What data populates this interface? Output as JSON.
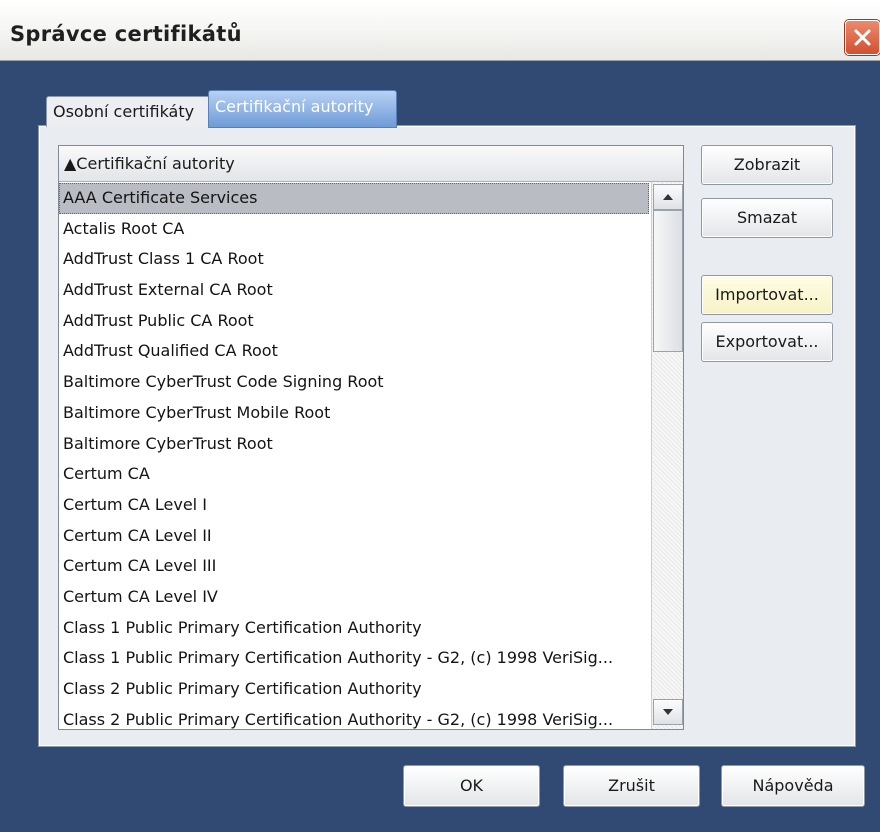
{
  "window": {
    "title": "Správce certifikátů",
    "close_icon": "close-icon"
  },
  "tabs": [
    {
      "label": "Osobní certifikáty",
      "active": false
    },
    {
      "label": "Certifikační autority",
      "active": true
    }
  ],
  "list": {
    "header": "▲Certifikační autority",
    "selected_index": 0,
    "items": [
      "AAA Certificate Services",
      "Actalis Root CA",
      "AddTrust Class 1 CA Root",
      "AddTrust External CA Root",
      "AddTrust Public CA Root",
      "AddTrust Qualified CA Root",
      "Baltimore CyberTrust Code Signing Root",
      "Baltimore CyberTrust Mobile Root",
      "Baltimore CyberTrust Root",
      "Certum CA",
      "Certum CA Level I",
      "Certum CA Level II",
      "Certum CA Level III",
      "Certum CA Level IV",
      "Class 1 Public Primary Certification Authority",
      "Class 1 Public Primary Certification Authority - G2, (c) 1998 VeriSig...",
      "Class 2 Public Primary Certification Authority",
      "Class 2 Public Primary Certification Authority - G2, (c) 1998 VeriSig..."
    ]
  },
  "side_buttons": {
    "view": "Zobrazit",
    "delete": "Smazat",
    "import": "Importovat...",
    "export": "Exportovat..."
  },
  "bottom_buttons": {
    "ok": "OK",
    "cancel": "Zrušit",
    "help": "Nápověda"
  }
}
